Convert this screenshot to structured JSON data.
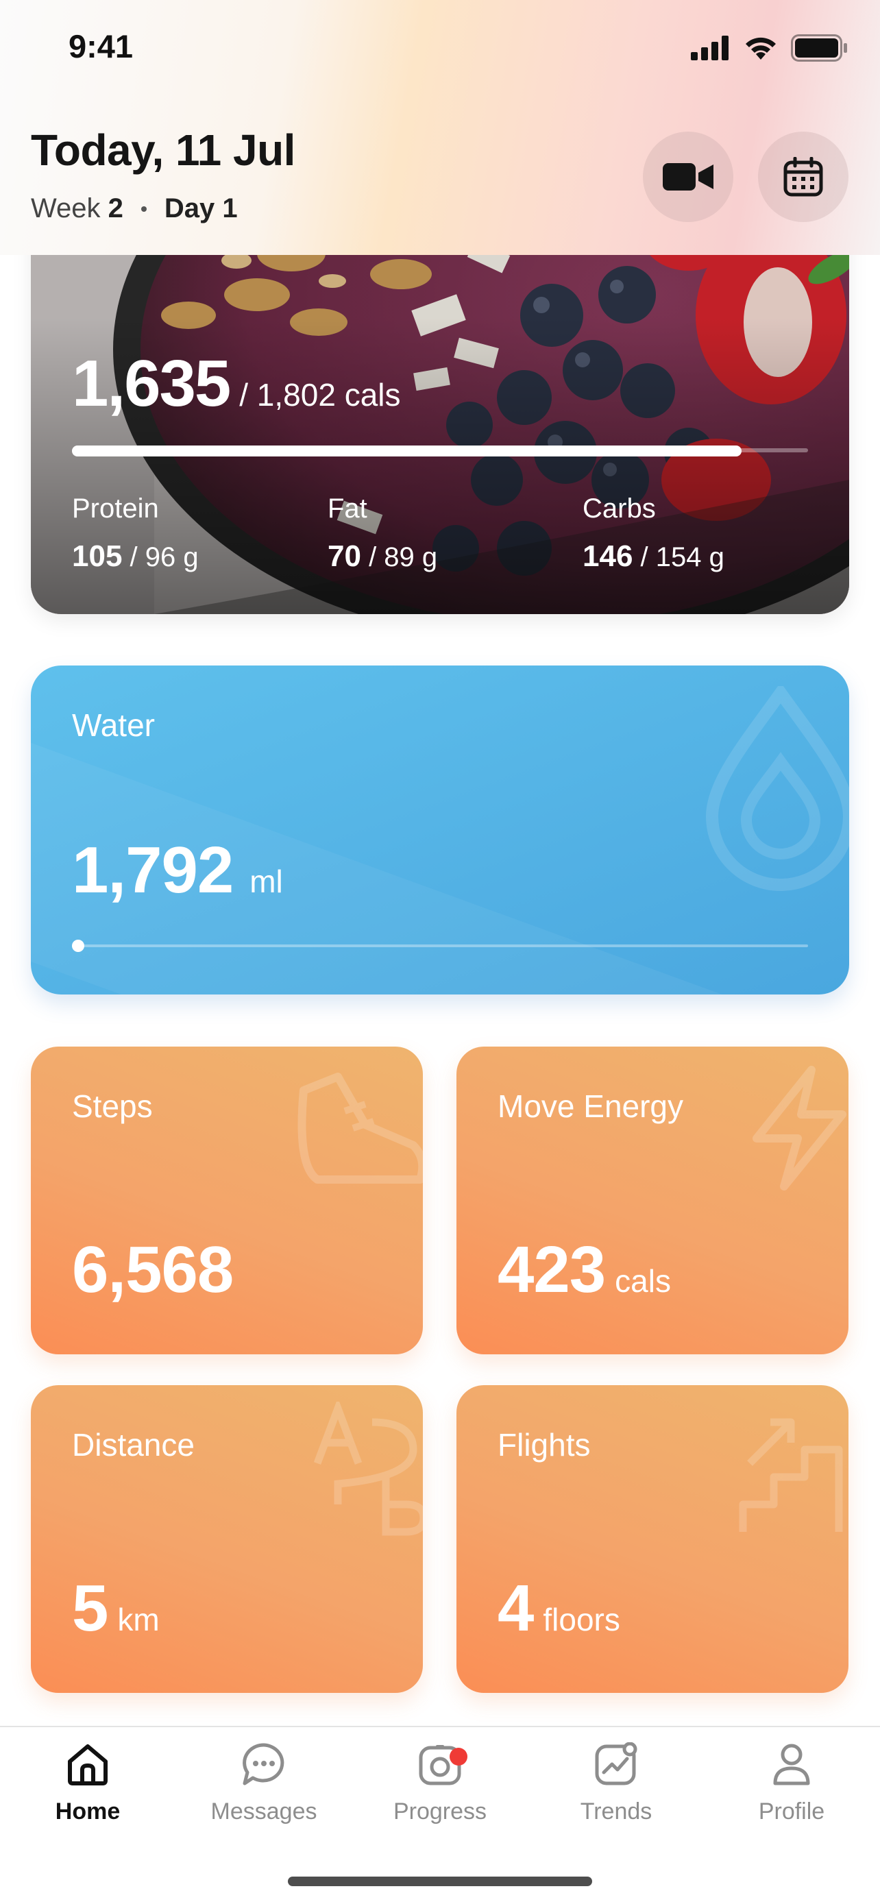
{
  "status_bar": {
    "time": "9:41"
  },
  "header": {
    "title": "Today, 11 Jul",
    "week_label": "Week",
    "week_number": "2",
    "day_label": "Day 1",
    "video_button_icon": "video-camera-icon",
    "calendar_button_icon": "calendar-icon"
  },
  "calories": {
    "consumed": "1,635",
    "goal_text": "/ 1,802 cals",
    "progress_fraction": 0.91,
    "macros": [
      {
        "label": "Protein",
        "value": "105",
        "goal": "/ 96 g"
      },
      {
        "label": "Fat",
        "value": "70",
        "goal": "/ 89 g"
      },
      {
        "label": "Carbs",
        "value": "146",
        "goal": "/ 154 g"
      }
    ]
  },
  "water": {
    "label": "Water",
    "value": "1,792",
    "unit": "ml",
    "progress_fraction": 0.0
  },
  "tiles": {
    "steps": {
      "label": "Steps",
      "value": "6,568",
      "unit": ""
    },
    "move_energy": {
      "label": "Move Energy",
      "value": "423",
      "unit": "cals"
    },
    "distance": {
      "label": "Distance",
      "value": "5",
      "unit": "km"
    },
    "flights": {
      "label": "Flights",
      "value": "4",
      "unit": "floors"
    }
  },
  "tabbar": {
    "items": [
      {
        "label": "Home",
        "icon": "home-icon",
        "active": true
      },
      {
        "label": "Messages",
        "icon": "chat-bubble-icon",
        "active": false
      },
      {
        "label": "Progress",
        "icon": "camera-progress-icon",
        "active": false,
        "badge": true
      },
      {
        "label": "Trends",
        "icon": "trend-chart-icon",
        "active": false
      },
      {
        "label": "Profile",
        "icon": "person-icon",
        "active": false
      }
    ]
  },
  "colors": {
    "water_card": "#4aa7df",
    "activity_tile": "#f4a46a",
    "badge": "#ef3b36"
  }
}
